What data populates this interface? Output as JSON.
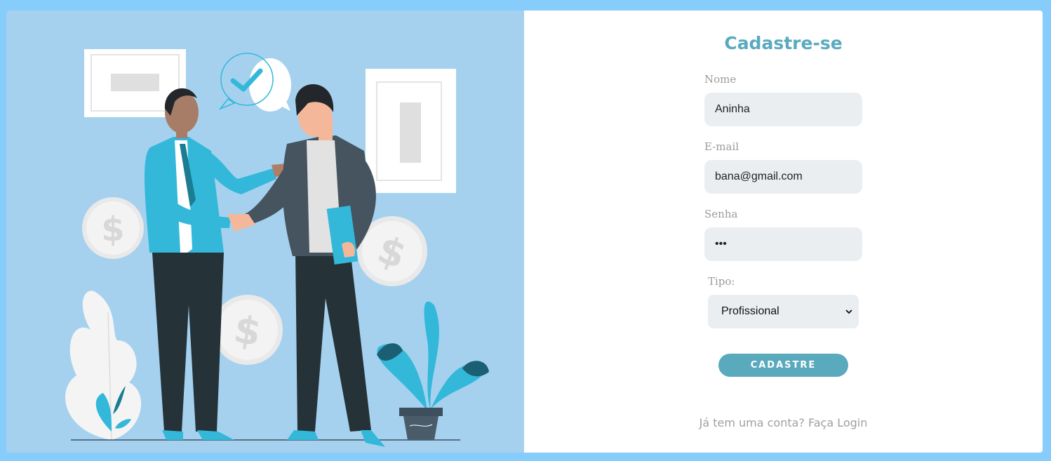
{
  "form": {
    "title": "Cadastre-se",
    "name_label": "Nome",
    "name_value": "Aninha",
    "email_label": "E-mail",
    "email_value": "bana@gmail.com",
    "password_label": "Senha",
    "password_value": "•••",
    "type_label": "Tipo:",
    "type_selected": "Profissional",
    "submit_label": "CADASTRE",
    "footer_text": "Já tem uma conta?",
    "login_link": "Faça Login"
  },
  "colors": {
    "background": "#86cdfb",
    "illustration_bg": "#a5d1ef",
    "accent": "#5aaabe",
    "input_bg": "#ebeef0"
  },
  "icons": {
    "checkmark": "check-bubble-icon",
    "coin": "dollar-coin-icon",
    "select_arrow": "chevron-down-icon"
  }
}
